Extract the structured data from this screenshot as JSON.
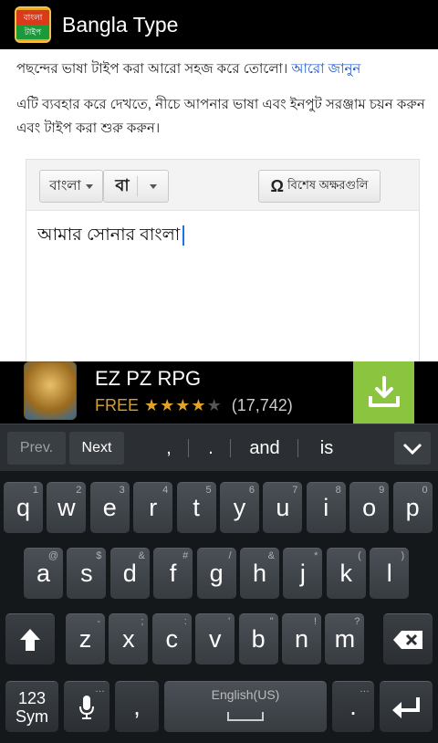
{
  "action_bar": {
    "icon_line1": "বাংলা",
    "icon_line2": "টাইপ",
    "title": "Bangla Type"
  },
  "page": {
    "para1_text": "পছন্দের ভাষা টাইপ করা আরো সহজ করে তোলো। ",
    "para1_link": "আরো জানুন",
    "para2": "এটি ব্যবহার করে দেখতে, নীচে আপনার ভাষা এবং ইনপুট সরঞ্জাম চয়ন করুন এবং টাইপ করা শুরু করুন।",
    "editor": {
      "lang_button": "বাংলা",
      "script_button": "বা",
      "special_button": "বিশেষ অক্ষরগুলি",
      "omega": "Ω",
      "text": "আমার সোনার বাংলা"
    }
  },
  "ad": {
    "title": "EZ PZ RPG",
    "price": "FREE",
    "stars_filled": "★★★★",
    "stars_empty": "★",
    "rating": 4,
    "count": "(17,742)",
    "download_icon": "download-icon"
  },
  "suggestions": {
    "prev": "Prev.",
    "next": "Next",
    "comma": ",",
    "dot": ".",
    "word1": "and",
    "word2": "is",
    "collapse_icon": "chevron-down-icon"
  },
  "keyboard": {
    "row1": [
      {
        "k": "q",
        "h": "1"
      },
      {
        "k": "w",
        "h": "2"
      },
      {
        "k": "e",
        "h": "3"
      },
      {
        "k": "r",
        "h": "4"
      },
      {
        "k": "t",
        "h": "5"
      },
      {
        "k": "y",
        "h": "6"
      },
      {
        "k": "u",
        "h": "7"
      },
      {
        "k": "i",
        "h": "8"
      },
      {
        "k": "o",
        "h": "9"
      },
      {
        "k": "p",
        "h": "0"
      }
    ],
    "row2": [
      {
        "k": "a",
        "h": "@"
      },
      {
        "k": "s",
        "h": "$"
      },
      {
        "k": "d",
        "h": "&"
      },
      {
        "k": "f",
        "h": "#"
      },
      {
        "k": "g",
        "h": "/"
      },
      {
        "k": "h",
        "h": "&"
      },
      {
        "k": "j",
        "h": "*"
      },
      {
        "k": "k",
        "h": "("
      },
      {
        "k": "l",
        "h": ")"
      }
    ],
    "row3": [
      {
        "k": "z",
        "h": "-"
      },
      {
        "k": "x",
        "h": ";"
      },
      {
        "k": "c",
        "h": ":"
      },
      {
        "k": "v",
        "h": "'"
      },
      {
        "k": "b",
        "h": "\""
      },
      {
        "k": "n",
        "h": "!"
      },
      {
        "k": "m",
        "h": "?"
      }
    ],
    "sym_key_line1": "123",
    "sym_key_line2": "Sym",
    "comma_key": ",",
    "space_label": "English(US)",
    "period_key": ".",
    "period_hint": "…",
    "mic_hint": "…",
    "shift_icon": "shift-icon",
    "backspace_icon": "backspace-icon",
    "enter_icon": "enter-icon",
    "mic_icon": "mic-icon"
  }
}
